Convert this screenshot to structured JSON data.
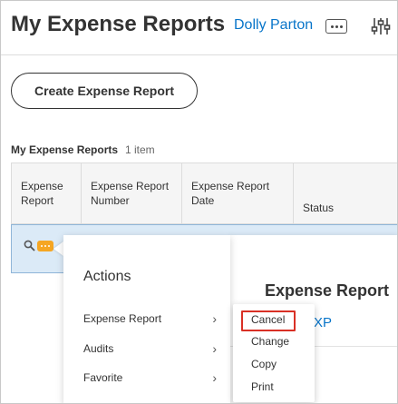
{
  "header": {
    "title": "My Expense Reports",
    "user_name": "Dolly Parton",
    "more_icon": "ellipsis-icon",
    "filter_icon": "filter-sliders-icon"
  },
  "toolbar": {
    "create_label": "Create Expense Report"
  },
  "section": {
    "label": "My Expense Reports",
    "count": "1 item"
  },
  "table": {
    "columns": [
      "Expense Report",
      "Expense Report Number",
      "Expense Report Date",
      "Status"
    ]
  },
  "row": {
    "icons": [
      "magnifier-icon",
      "related-actions-icon"
    ]
  },
  "detail_popup": {
    "title": "Expense Report",
    "link": "XP"
  },
  "actions_menu": {
    "title": "Actions",
    "items": [
      {
        "label": "Expense Report",
        "submenu": true
      },
      {
        "label": "Audits",
        "submenu": true
      },
      {
        "label": "Favorite",
        "submenu": true
      }
    ]
  },
  "submenu": {
    "items": [
      "Cancel",
      "Change",
      "Copy",
      "Print"
    ],
    "highlighted": "Cancel"
  },
  "colors": {
    "link_blue": "#0875c9",
    "row_selected": "#dbeaf7",
    "related_orange": "#f5a623",
    "highlight_red": "#d93025"
  }
}
